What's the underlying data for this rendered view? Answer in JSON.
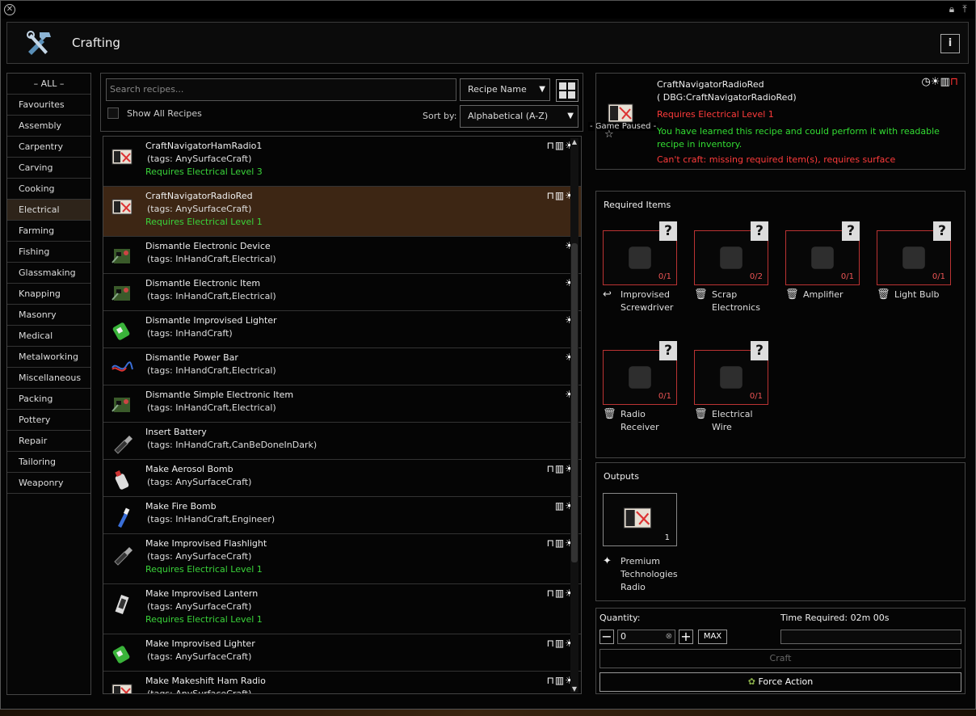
{
  "window": {
    "lock_icon": "lock-icon",
    "pin_icon": "pin-icon"
  },
  "header": {
    "title": "Crafting",
    "info_label": "i"
  },
  "categories": [
    "– ALL –",
    "Favourites",
    "Assembly",
    "Carpentry",
    "Carving",
    "Cooking",
    "Electrical",
    "Farming",
    "Fishing",
    "Glassmaking",
    "Knapping",
    "Masonry",
    "Medical",
    "Metalworking",
    "Miscellaneous",
    "Packing",
    "Pottery",
    "Repair",
    "Tailoring",
    "Weaponry"
  ],
  "active_category": "Electrical",
  "search": {
    "placeholder": "Search recipes...",
    "filter_value": "Recipe Name",
    "show_all_label": "Show All Recipes",
    "sort_label": "Sort by:",
    "sort_value": "Alphabetical (A-Z)"
  },
  "game_paused": "- Game Paused -",
  "recipes": [
    {
      "name": "CraftNavigatorHamRadio1",
      "tags": "(tags: AnySurfaceCraft)",
      "req": "Requires Electrical Level 3",
      "flags": "⊓▥☀",
      "icon": "radio-icon"
    },
    {
      "name": "CraftNavigatorRadioRed",
      "tags": "(tags: AnySurfaceCraft)",
      "req": "Requires Electrical Level 1",
      "flags": "⊓▥☀",
      "icon": "radio-icon"
    },
    {
      "name": "Dismantle Electronic Device",
      "tags": "(tags: InHandCraft,Electrical)",
      "req": "",
      "flags": "☀",
      "icon": "electronics-icon"
    },
    {
      "name": "Dismantle Electronic Item",
      "tags": "(tags: InHandCraft,Electrical)",
      "req": "",
      "flags": "☀",
      "icon": "electronics-icon"
    },
    {
      "name": "Dismantle Improvised Lighter",
      "tags": "(tags: InHandCraft)",
      "req": "",
      "flags": "☀",
      "icon": "lighter-icon"
    },
    {
      "name": "Dismantle Power Bar",
      "tags": "(tags: InHandCraft,Electrical)",
      "req": "",
      "flags": "☀",
      "icon": "wire-icon"
    },
    {
      "name": "Dismantle Simple Electronic Item",
      "tags": "(tags: InHandCraft,Electrical)",
      "req": "",
      "flags": "☀",
      "icon": "electronics-icon"
    },
    {
      "name": "Insert Battery",
      "tags": "(tags: InHandCraft,CanBeDoneInDark)",
      "req": "",
      "flags": "",
      "icon": "flashlight-icon"
    },
    {
      "name": "Make Aerosol Bomb",
      "tags": "(tags: AnySurfaceCraft)",
      "req": "",
      "flags": "⊓▥☀",
      "icon": "aerosol-icon"
    },
    {
      "name": "Make Fire Bomb",
      "tags": "(tags: InHandCraft,Engineer)",
      "req": "",
      "flags": "▥☀",
      "icon": "bottle-icon"
    },
    {
      "name": "Make Improvised Flashlight",
      "tags": "(tags: AnySurfaceCraft)",
      "req": "Requires Electrical Level 1",
      "flags": "⊓▥☀",
      "icon": "flashlight-icon"
    },
    {
      "name": "Make Improvised Lantern",
      "tags": "(tags: AnySurfaceCraft)",
      "req": "Requires Electrical Level 1",
      "flags": "⊓▥☀",
      "icon": "lantern-icon"
    },
    {
      "name": "Make Improvised Lighter",
      "tags": "(tags: AnySurfaceCraft)",
      "req": "",
      "flags": "⊓▥☀",
      "icon": "lighter-icon"
    },
    {
      "name": "Make Makeshift Ham Radio",
      "tags": "(tags: AnySurfaceCraft)",
      "req": "",
      "flags": "⊓▥☀",
      "icon": "radio-icon"
    }
  ],
  "detail": {
    "name": "CraftNavigatorRadioRed",
    "debug": "( DBG:CraftNavigatorRadioRed)",
    "requires": "Requires Electrical Level 1",
    "learned": "You have learned this recipe and could perform it with readable recipe in inventory.",
    "cant_craft": "Can't craft: missing required item(s), requires surface",
    "colors": {
      "red": "#ff3b3b",
      "green": "#33dd33"
    }
  },
  "required": {
    "title": "Required Items",
    "items": [
      {
        "label": "Improvised Screwdriver",
        "count": "0/1",
        "icon": "return-icon"
      },
      {
        "label": "Scrap Electronics",
        "count": "0/2",
        "icon": "trash-icon"
      },
      {
        "label": "Amplifier",
        "count": "0/1",
        "icon": "trash-icon"
      },
      {
        "label": "Light Bulb",
        "count": "0/1",
        "icon": "trash-icon"
      },
      {
        "label": "Radio Receiver",
        "count": "0/1",
        "icon": "trash-icon"
      },
      {
        "label": "Electrical Wire",
        "count": "0/1",
        "icon": "trash-icon"
      }
    ]
  },
  "outputs": {
    "title": "Outputs",
    "count": "1",
    "label": "Premium Technologies Radio"
  },
  "quantity": {
    "label": "Quantity:",
    "value": "0",
    "max": "MAX",
    "time": "Time Required: 02m 00s",
    "craft": "Craft",
    "force": "Force Action"
  }
}
